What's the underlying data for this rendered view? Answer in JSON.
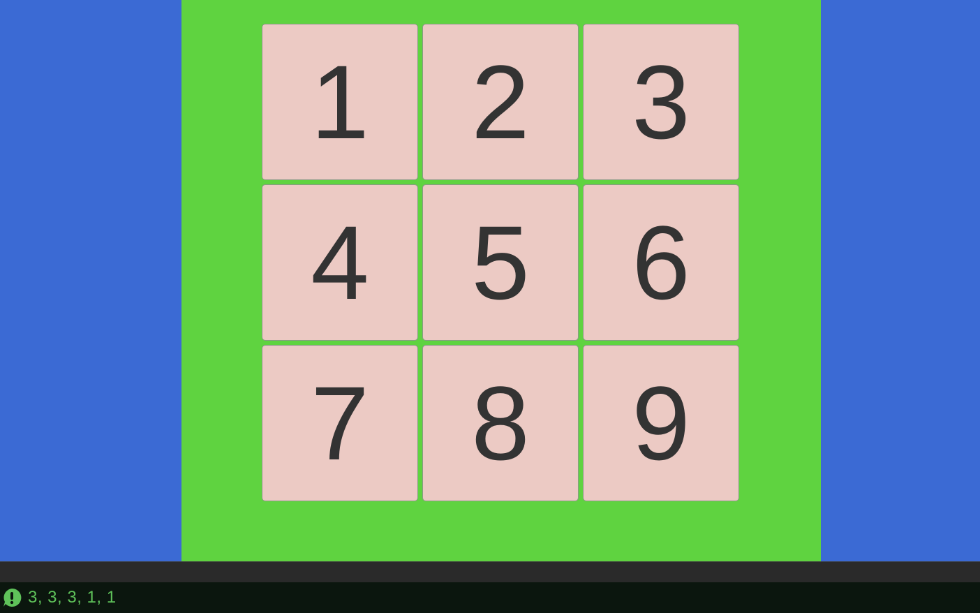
{
  "colors": {
    "background": "#3b6ad4",
    "board": "#5fd340",
    "tile": "#eccac4",
    "tile_text": "#333333",
    "console_bg": "#0b160e",
    "console_text": "#5fc25a"
  },
  "grid": {
    "tiles": [
      "1",
      "2",
      "3",
      "4",
      "5",
      "6",
      "7",
      "8",
      "9"
    ]
  },
  "console": {
    "icon": "exclamation-bubble-icon",
    "message": "3, 3, 3, 1, 1"
  }
}
